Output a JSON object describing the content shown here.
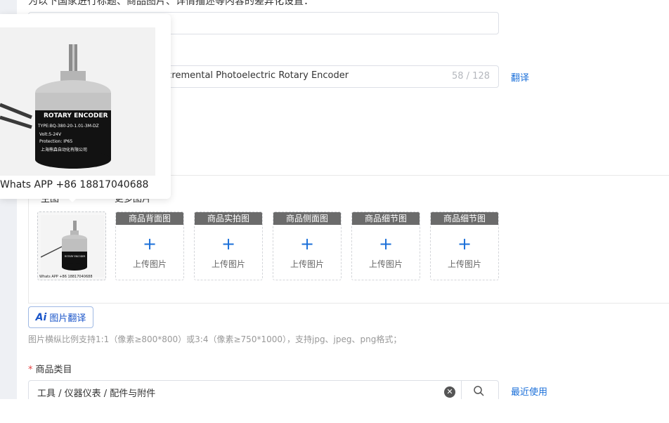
{
  "form": {
    "description": "为以下国家进行标题、商品图片、详情描述等内容的差异化设置：",
    "title_value": "ncremental Photoelectric Rotary Encoder",
    "title_counter": "58 / 128",
    "translate_link": "翻译"
  },
  "images": {
    "under_label_left": "主图",
    "under_label_right": "更多图片",
    "main_caption": "Whats APP +86 18817040688",
    "tiles": [
      {
        "header": "商品背面图",
        "upload": "上传图片"
      },
      {
        "header": "商品实拍图",
        "upload": "上传图片"
      },
      {
        "header": "商品侧面图",
        "upload": "上传图片"
      },
      {
        "header": "商品细节图",
        "upload": "上传图片"
      },
      {
        "header": "商品细节图",
        "upload": "上传图片"
      }
    ],
    "ai_translate_icon": "Ai",
    "ai_translate_label": "图片翻译",
    "hint": "图片横纵比例支持1:1（像素≥800*800）或3:4（像素≥750*1000），支持jpg、jpeg、png格式；"
  },
  "category": {
    "label": "商品类目",
    "value": "工具 / 仪器仪表 / 配件与附件",
    "recent_link": "最近使用"
  },
  "popover": {
    "caption": "Whats APP +86 18817040688",
    "encoder_label": "ROTARY  ENCODER",
    "encoder_type": "TYPE:BQ-380-20-1.01-3M-DZ",
    "encoder_volt": "Volt:5-24V",
    "encoder_protection": "Protection:  IP65",
    "encoder_maker": "上海熊森自动化有限公司"
  },
  "colors": {
    "accent": "#1a6fd9",
    "tile_header_bg": "#6b6b6b",
    "required_star": "#e54545"
  }
}
